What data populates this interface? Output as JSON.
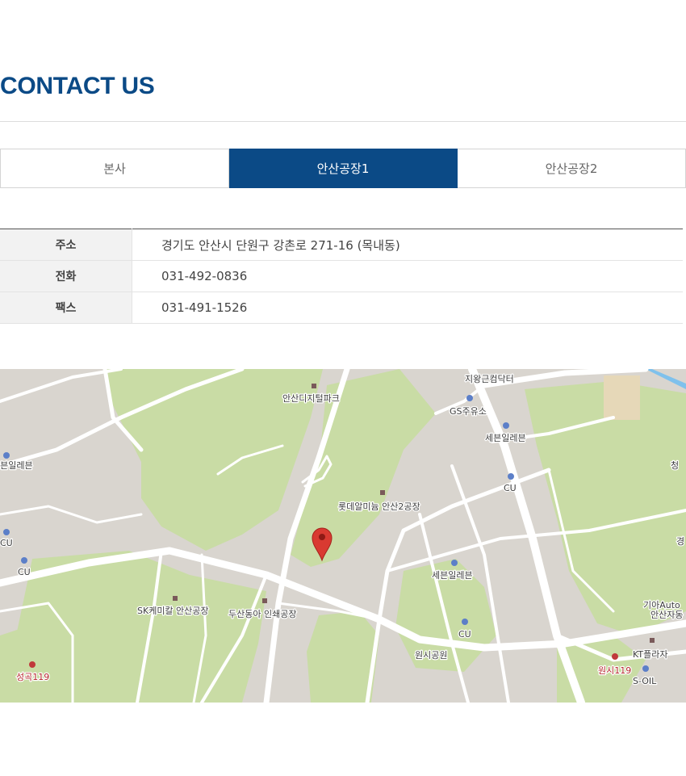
{
  "page": {
    "title": "CONTACT US"
  },
  "tabs": [
    {
      "label": "본사",
      "active": false
    },
    {
      "label": "안산공장1",
      "active": true
    },
    {
      "label": "안산공장2",
      "active": false
    }
  ],
  "info": {
    "rows": [
      {
        "label": "주소",
        "value": "경기도 안산시 단원구 강촌로 271-16 (목내동)"
      },
      {
        "label": "전화",
        "value": "031-492-0836"
      },
      {
        "label": "팩스",
        "value": "031-491-1526"
      }
    ]
  },
  "map": {
    "marker_icon": "map-pin-icon",
    "labels": {
      "digital_park": "안산디지털파크",
      "jiwang": "지왕근컴닥터",
      "gs": "GS주유소",
      "seven_top": "세븐일레븐",
      "seven_left": "세븐일레븐",
      "seven_mid": "세븐일레븐",
      "cheong": "청",
      "cu_right": "CU",
      "cu_left1": "CU",
      "cu_left2": "CU",
      "cu_bottom": "CU",
      "lotte": "롯데알미늄 안산2공장",
      "sk": "SK케미칼 안산공장",
      "doosan": "두산동아 인쇄공장",
      "park": "원시공원",
      "kia1": "기아Auto",
      "kia2": "안산자동",
      "kt": "KT플라자",
      "wonsi119": "원시119",
      "soil": "S-OIL",
      "seonggok119": "성곡119",
      "gyeong": "경"
    },
    "colors": {
      "land": "#d9d5cf",
      "green": "#c9dca5",
      "road": "#ffffff",
      "pin": "#d93a31"
    }
  }
}
